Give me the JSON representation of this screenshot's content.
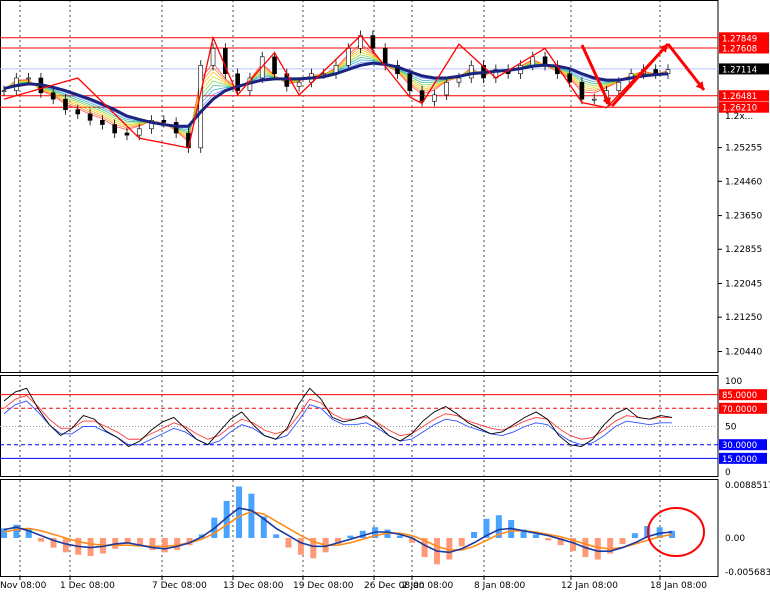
{
  "chart_data": [
    {
      "type": "line",
      "title": "",
      "price_axis": [
        "1.25255",
        "1.24460",
        "1.23650",
        "1.22855",
        "1.22045",
        "1.21250",
        "1.20440"
      ],
      "ylim": [
        1.2005,
        1.286
      ],
      "levels": [
        {
          "label": "1.27849",
          "value": 1.27849,
          "color": "#ff0000"
        },
        {
          "label": "1.27608",
          "value": 1.27608,
          "color": "#ff0000"
        },
        {
          "label": "1.27114",
          "value": 1.27114,
          "color": "#000000"
        },
        {
          "label": "1.26481",
          "value": 1.26481,
          "color": "#ff0000"
        },
        {
          "label": "1.26210",
          "value": 1.2621,
          "color": "#ff0000"
        }
      ],
      "extra_label": "1.2x...",
      "close_series": [
        1.266,
        1.269,
        1.269,
        1.2655,
        1.264,
        1.2615,
        1.2605,
        1.259,
        1.258,
        1.256,
        1.2555,
        1.257,
        1.259,
        1.2585,
        1.256,
        1.2525,
        1.272,
        1.276,
        1.27,
        1.266,
        1.269,
        1.274,
        1.27,
        1.267,
        1.268,
        1.27,
        1.27,
        1.272,
        1.276,
        1.279,
        1.276,
        1.272,
        1.27,
        1.266,
        1.2635,
        1.265,
        1.268,
        1.269,
        1.272,
        1.269,
        1.271,
        1.27,
        1.272,
        1.274,
        1.272,
        1.27,
        1.268,
        1.264,
        1.264,
        1.266,
        1.268,
        1.27,
        1.271,
        1.27,
        1.271
      ],
      "ma_series": [
        1.2665,
        1.2672,
        1.2676,
        1.2674,
        1.2668,
        1.266,
        1.265,
        1.264,
        1.2628,
        1.2615,
        1.26,
        1.2592,
        1.2585,
        1.258,
        1.2576,
        1.2576,
        1.261,
        1.264,
        1.266,
        1.267,
        1.2678,
        1.2685,
        1.2688,
        1.2688,
        1.2688,
        1.269,
        1.2693,
        1.27,
        1.271,
        1.272,
        1.2725,
        1.2722,
        1.2716,
        1.2705,
        1.2695,
        1.269,
        1.269,
        1.2694,
        1.27,
        1.2703,
        1.2706,
        1.2708,
        1.2712,
        1.2718,
        1.272,
        1.2718,
        1.2712,
        1.27,
        1.269,
        1.2685,
        1.2685,
        1.269,
        1.2695,
        1.2698,
        1.27
      ]
    },
    {
      "type": "line",
      "title": "",
      "axis_labels": [
        "100",
        "85.0000",
        "70.0000",
        "50",
        "30.0000",
        "15.0000",
        "0"
      ],
      "ylim": [
        0,
        100
      ],
      "levels": [
        {
          "label": "85.0000",
          "value": 85,
          "color": "#ff0000",
          "style": "solid"
        },
        {
          "label": "70.0000",
          "value": 70,
          "color": "#ff0000",
          "style": "dashed"
        },
        {
          "label": "50",
          "value": 50,
          "color": "#999999",
          "style": "dotted"
        },
        {
          "label": "30.0000",
          "value": 30,
          "color": "#0000ff",
          "style": "dashed"
        },
        {
          "label": "15.0000",
          "value": 15,
          "color": "#0000ff",
          "style": "solid"
        }
      ],
      "series_k": [
        78,
        88,
        92,
        70,
        52,
        40,
        48,
        62,
        58,
        45,
        38,
        28,
        34,
        46,
        55,
        60,
        48,
        36,
        30,
        44,
        58,
        66,
        52,
        40,
        36,
        48,
        74,
        92,
        80,
        60,
        55,
        58,
        62,
        52,
        40,
        34,
        42,
        56,
        66,
        72,
        64,
        54,
        48,
        42,
        44,
        52,
        60,
        66,
        58,
        40,
        30,
        28,
        36,
        52,
        64,
        70,
        60,
        58,
        62,
        60
      ],
      "series_d": [
        70,
        80,
        84,
        72,
        58,
        48,
        48,
        56,
        56,
        50,
        44,
        36,
        36,
        42,
        48,
        54,
        50,
        42,
        36,
        40,
        50,
        58,
        54,
        46,
        42,
        46,
        62,
        80,
        76,
        64,
        58,
        58,
        60,
        54,
        46,
        40,
        42,
        50,
        58,
        64,
        62,
        56,
        52,
        48,
        46,
        50,
        56,
        60,
        58,
        48,
        40,
        36,
        38,
        46,
        56,
        62,
        60,
        58,
        60,
        60
      ]
    },
    {
      "type": "bar",
      "title": "",
      "axis_labels": [
        "0.0088517",
        "0.00",
        "-0.005683"
      ],
      "ylim": [
        -0.005683,
        0.0088517
      ],
      "histogram": [
        0.0016,
        0.0022,
        0.0014,
        -0.0006,
        -0.0016,
        -0.0024,
        -0.0028,
        -0.003,
        -0.0026,
        -0.0018,
        -0.001,
        -0.0014,
        -0.002,
        -0.0024,
        -0.002,
        -0.0012,
        0.0006,
        0.0034,
        0.0062,
        0.0086,
        0.0074,
        0.0036,
        0.0006,
        -0.0016,
        -0.0028,
        -0.0034,
        -0.0024,
        -0.001,
        0.0004,
        0.0012,
        0.0018,
        0.0014,
        0.0004,
        -0.0008,
        -0.0032,
        -0.0044,
        -0.0036,
        -0.0014,
        0.001,
        0.0032,
        0.0038,
        0.003,
        0.0014,
        0.0006,
        -0.0004,
        -0.0012,
        -0.0022,
        -0.0032,
        -0.0036,
        -0.0026,
        -0.001,
        0.0008,
        0.002,
        0.0018,
        0.0012
      ],
      "signal": [
        0.001,
        0.0014,
        0.0016,
        0.0012,
        0.0006,
        0.0,
        -0.0006,
        -0.001,
        -0.0012,
        -0.0012,
        -0.0012,
        -0.0013,
        -0.0014,
        -0.0014,
        -0.0012,
        -0.0008,
        -0.0002,
        0.0008,
        0.0022,
        0.0036,
        0.0044,
        0.004,
        0.0028,
        0.0016,
        0.0004,
        -0.0006,
        -0.0012,
        -0.0012,
        -0.0008,
        -0.0002,
        0.0004,
        0.0008,
        0.0008,
        0.0004,
        -0.0004,
        -0.0014,
        -0.002,
        -0.002,
        -0.0014,
        -0.0004,
        0.0006,
        0.0012,
        0.0012,
        0.001,
        0.0006,
        0.0002,
        -0.0004,
        -0.001,
        -0.0016,
        -0.0018,
        -0.0016,
        -0.001,
        -0.0004,
        0.0002,
        0.0006
      ],
      "main": [
        0.0014,
        0.0018,
        0.0012,
        0.0004,
        -0.0004,
        -0.001,
        -0.0014,
        -0.0016,
        -0.0014,
        -0.001,
        -0.0008,
        -0.0012,
        -0.0016,
        -0.0018,
        -0.0014,
        -0.0008,
        0.0002,
        0.0016,
        0.0034,
        0.005,
        0.0046,
        0.0032,
        0.0016,
        0.0004,
        -0.0008,
        -0.0014,
        -0.0014,
        -0.0008,
        -0.0002,
        0.0004,
        0.001,
        0.001,
        0.0006,
        0.0,
        -0.0012,
        -0.0022,
        -0.0024,
        -0.0018,
        -0.0008,
        0.0004,
        0.0014,
        0.0016,
        0.0012,
        0.0008,
        0.0004,
        -0.0002,
        -0.0008,
        -0.0016,
        -0.0022,
        -0.0022,
        -0.0016,
        -0.0008,
        0.0002,
        0.0008,
        0.001
      ]
    }
  ],
  "time_axis": [
    "Nov 08:00",
    "1 Dec 08:00",
    "7 Dec 08:00",
    "13 Dec 08:00",
    "19 Dec 08:00",
    "26 Dec 08:00",
    "2 Jan 08:00",
    "8 Jan 08:00",
    "12 Jan 08:00",
    "18 Jan 08:00"
  ],
  "colors": {
    "bull": "#4aa3ff",
    "bear": "#ff9a78",
    "ma": "#1a237e",
    "macd_main": "#1a3a9f",
    "macd_signal": "#ff8c1a",
    "stoch_k": "#000000",
    "stoch_d": "#ff3b3b",
    "stoch_slow": "#3050ff",
    "levels": "#ff0000",
    "annotation": "#ff0000"
  }
}
